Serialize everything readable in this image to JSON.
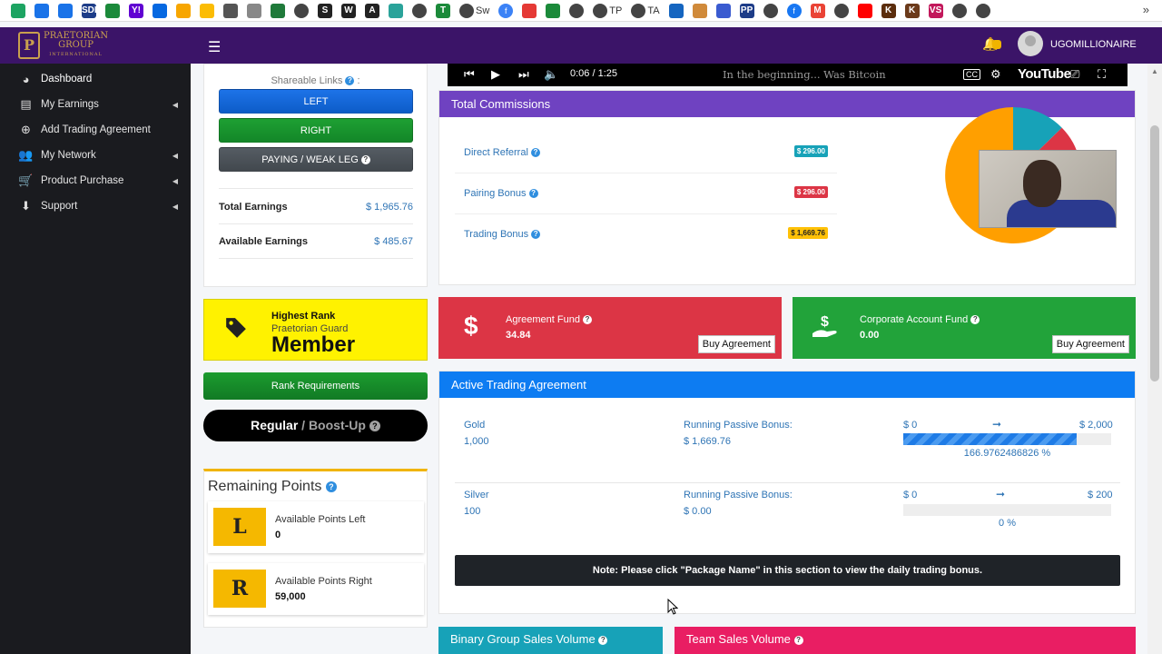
{
  "bookmarks": {
    "items": [
      {
        "icon": "drive-icon",
        "color": "#1da462"
      },
      {
        "icon": "cloud-icon",
        "color": "#1a73e8"
      },
      {
        "icon": "gear-apps-icon",
        "color": "#1a73e8"
      },
      {
        "icon": "sdd-icon",
        "label": "SDD",
        "color": "#1d3c88"
      },
      {
        "icon": "plus-green-icon",
        "color": "#1b8a3a"
      },
      {
        "icon": "yahoo-icon",
        "label": "Y!",
        "color": "#6001d2"
      },
      {
        "icon": "infinity-icon",
        "color": "#0668e1"
      },
      {
        "icon": "pie-icon",
        "color": "#f7a600"
      },
      {
        "icon": "ads-icon",
        "color": "#fbbc04"
      },
      {
        "icon": "layers-icon",
        "color": "#555"
      },
      {
        "icon": "swirl-icon",
        "color": "#888"
      },
      {
        "icon": "pillars-icon",
        "color": "#1f7a3a"
      },
      {
        "icon": "globe-icon",
        "color": "#444"
      },
      {
        "icon": "s-icon",
        "label": "S",
        "color": "#222"
      },
      {
        "icon": "w-icon",
        "label": "W",
        "color": "#222"
      },
      {
        "icon": "a-icon",
        "label": "A",
        "color": "#222"
      },
      {
        "icon": "photo-icon",
        "color": "#2aa39a"
      },
      {
        "icon": "globe-icon",
        "color": "#444"
      },
      {
        "icon": "t-icon",
        "label": "T",
        "color": "#1b8a3a"
      },
      {
        "icon": "globe-icon",
        "color": "#444",
        "label": "Sw"
      },
      {
        "icon": "f-circle-icon",
        "label": "f",
        "color": "#3b82f6"
      },
      {
        "icon": "download-icon",
        "color": "#e53935"
      },
      {
        "icon": "plus-green-icon",
        "color": "#1b8a3a"
      },
      {
        "icon": "globe-icon",
        "color": "#444"
      },
      {
        "icon": "globe-icon",
        "color": "#444",
        "label": "TP"
      },
      {
        "icon": "globe-icon",
        "color": "#444",
        "label": "TA"
      },
      {
        "icon": "chart-icon",
        "color": "#1565c0"
      },
      {
        "icon": "flower-icon",
        "color": "#d08a3a"
      },
      {
        "icon": "plane-icon",
        "color": "#3a5bd0"
      },
      {
        "icon": "pp-icon",
        "label": "PP",
        "color": "#1d3c88"
      },
      {
        "icon": "globe-icon",
        "color": "#444"
      },
      {
        "icon": "facebook-icon",
        "label": "f",
        "color": "#1877f2"
      },
      {
        "icon": "gmail-icon",
        "label": "M",
        "color": "#ea4335"
      },
      {
        "icon": "globe-icon",
        "color": "#444"
      },
      {
        "icon": "youtube-icon",
        "color": "#ff0000"
      },
      {
        "icon": "k-icon",
        "label": "K",
        "color": "#5b2d0c"
      },
      {
        "icon": "k-icon",
        "label": "K",
        "color": "#6b3a1a"
      },
      {
        "icon": "vs-icon",
        "label": "VS",
        "color": "#c2185b"
      },
      {
        "icon": "globe-icon",
        "color": "#444"
      },
      {
        "icon": "globe-icon",
        "color": "#444"
      }
    ]
  },
  "topbar": {
    "logo_line1": "PRAETORIAN",
    "logo_line2": "GROUP",
    "logo_line3": "INTERNATIONAL",
    "username": "UGOMILLIONAIRE",
    "brand_color": "#3b1468"
  },
  "sidebar": {
    "items": [
      {
        "label": "Dashboard",
        "icon": "dashboard-icon",
        "caret": false
      },
      {
        "label": "My Earnings",
        "icon": "money-icon",
        "caret": true
      },
      {
        "label": "Add Trading Agreement",
        "icon": "plus-circle-icon",
        "caret": false
      },
      {
        "label": "My Network",
        "icon": "users-icon",
        "caret": true
      },
      {
        "label": "Product Purchase",
        "icon": "cart-icon",
        "caret": true
      },
      {
        "label": "Support",
        "icon": "file-download-icon",
        "caret": true
      }
    ]
  },
  "share": {
    "label": "Shareable Links",
    "left": "LEFT",
    "right": "RIGHT",
    "paying": "PAYING / WEAK LEG"
  },
  "earnings": {
    "total_label": "Total Earnings",
    "total_value": "$ 1,965.76",
    "available_label": "Available Earnings",
    "available_value": "$ 485.67"
  },
  "rank": {
    "title": "Highest Rank",
    "subtitle": "Praetorian Guard",
    "main": "Member",
    "requirements": "Rank Requirements",
    "regular": "Regular",
    "boost": " / Boost-Up"
  },
  "points": {
    "title": "Remaining Points",
    "left_letter": "L",
    "left_label": "Available Points Left",
    "left_value": "0",
    "right_letter": "R",
    "right_label": "Available Points Right",
    "right_value": "59,000"
  },
  "video": {
    "time": "0:06 / 1:25",
    "title": "In the beginning... Was Bitcoin",
    "cc": "CC",
    "brand": "YouTube"
  },
  "commissions": {
    "title": "Total Commissions",
    "rows": [
      {
        "label": "Direct Referral",
        "badge": "$ 296.00",
        "color": "#17a2b8"
      },
      {
        "label": "Pairing Bonus",
        "badge": "$ 296.00",
        "color": "#dc3545"
      },
      {
        "label": "Trading Bonus",
        "badge": "$ 1,669.76",
        "color": "#ffc107"
      }
    ],
    "pie_colors": [
      "#17a2b8",
      "#dc3545",
      "#ff9f00"
    ]
  },
  "funds": {
    "agreement_label": "Agreement Fund",
    "agreement_value": "34.84",
    "agreement_button": "Buy Agreement",
    "agreement_color": "#dc3545",
    "corporate_label": "Corporate Account Fund",
    "corporate_value": "0.00",
    "corporate_button": "Buy Agreement",
    "corporate_color": "#22a33a"
  },
  "active": {
    "title": "Active Trading Agreement",
    "note": "Note: Please click \"Package Name\" in this section to view the daily trading bonus.",
    "rows": [
      {
        "name": "Gold",
        "amount": "1,000",
        "bonus_label": "Running Passive Bonus:",
        "bonus_value": "$ 1,669.76",
        "min": "$ 0",
        "max": "$ 2,000",
        "percent_text": "166.9762486826 %",
        "progress": 0.835
      },
      {
        "name": "Silver",
        "amount": "100",
        "bonus_label": "Running Passive Bonus:",
        "bonus_value": "$ 0.00",
        "min": "$ 0",
        "max": "$ 200",
        "percent_text": "0 %",
        "progress": 0
      }
    ]
  },
  "bottom": {
    "binary": "Binary Group Sales Volume",
    "team": "Team Sales Volume",
    "binary_color": "#17a2b8",
    "team_color": "#e91e63"
  }
}
